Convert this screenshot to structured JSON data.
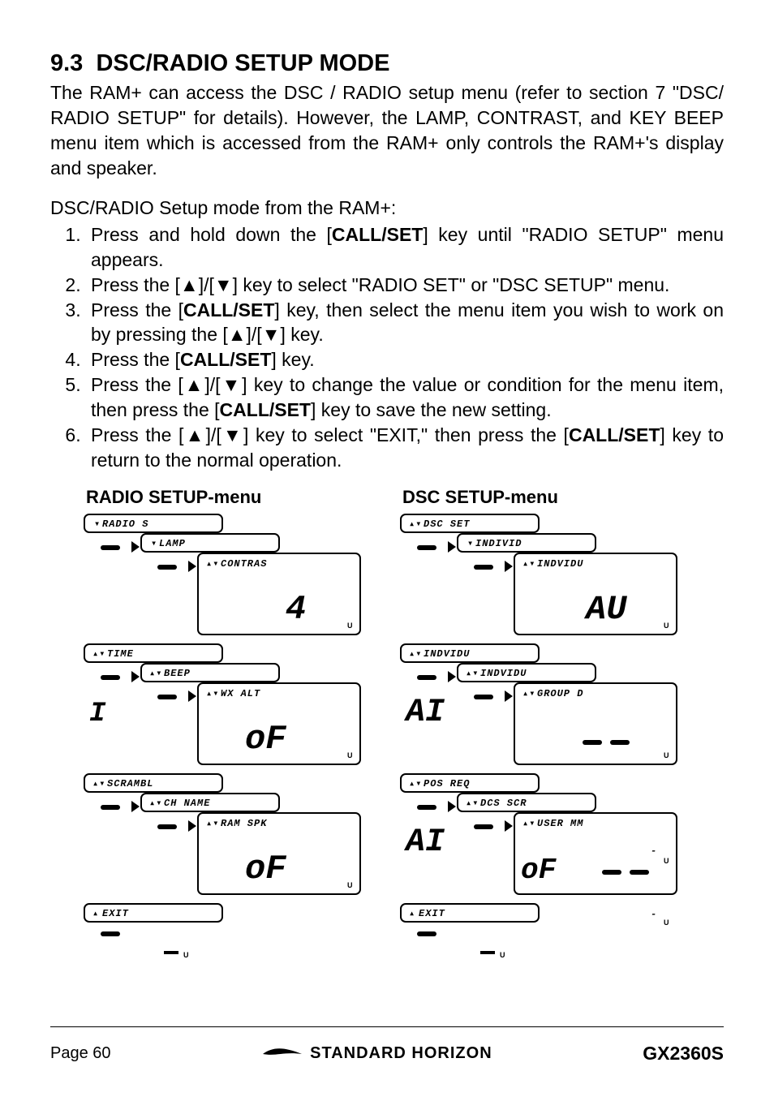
{
  "section": {
    "number": "9.3",
    "title": "DSC/RADIO SETUP MODE"
  },
  "intro": "The RAM+ can access the DSC / RADIO setup menu (refer to section 7  \"DSC/ RADIO SETUP\" for details). However, the LAMP, CONTRAST, and KEY BEEP menu item which is accessed from the RAM+ only controls the RAM+'s display and speaker.",
  "sub_intro": "DSC/RADIO Setup mode from the RAM+:",
  "steps": [
    {
      "pre": "Press and hold down the [",
      "bold": "CALL/SET",
      "post": "] key until \"RADIO SETUP\" menu appears."
    },
    {
      "pre": "Press the [▲]/[▼] key to select \"RADIO SET\" or \"DSC SETUP\" menu.",
      "bold": "",
      "post": ""
    },
    {
      "pre": "Press the [",
      "bold": "CALL/SET",
      "post": "] key, then select the menu item you wish to work on by pressing the [▲]/[▼] key."
    },
    {
      "pre": "Press the [",
      "bold": "CALL/SET",
      "post": "] key."
    },
    {
      "pre": "Press the [▲]/[▼] key to change the value or condition for the menu item, then press the [",
      "bold": "CALL/SET",
      "post": "] key to save the new setting."
    },
    {
      "pre": "Press the [▲]/[▼] key to select \"EXIT,\" then press the [",
      "bold": "CALL/SET",
      "post": "] key to return to the normal operation."
    }
  ],
  "menus": {
    "left": {
      "title": "RADIO SETUP-menu",
      "items": [
        "RADIO S",
        "LAMP",
        "CONTRAS",
        "TIME",
        "BEEP",
        "WX ALT",
        "SCRAMBL",
        "CH NAME",
        "RAM SPK",
        "EXIT"
      ],
      "big": [
        "4",
        "oF",
        "oF"
      ]
    },
    "right": {
      "title": "DSC SETUP-menu",
      "items": [
        "DSC SET",
        "INDIVID",
        "INDVIDU",
        "INDVIDU",
        "INDVIDU",
        "GROUP D",
        "POS REQ",
        "DCS SCR",
        "USER MM",
        "EXIT"
      ],
      "big": [
        "AU",
        "AI",
        "oF"
      ]
    }
  },
  "footer": {
    "page": "Page 60",
    "brand": "STANDARD HORIZON",
    "model": "GX2360S"
  }
}
